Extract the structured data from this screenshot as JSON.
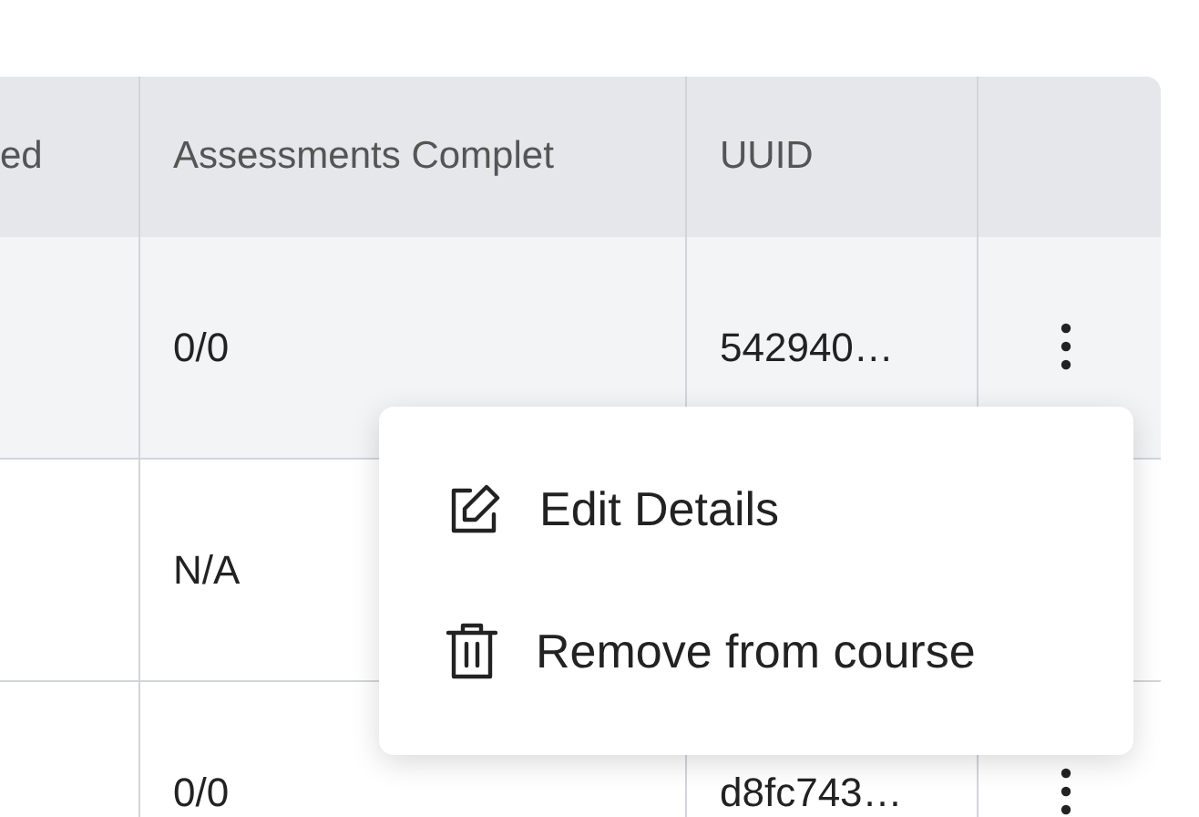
{
  "table": {
    "columns": [
      "ed",
      "Assessments Complet",
      "UUID",
      ""
    ],
    "rows": [
      {
        "assessments": "0/0",
        "uuid": "542940…",
        "highlighted": true
      },
      {
        "assessments": "N/A",
        "uuid": "",
        "highlighted": false
      },
      {
        "assessments": "0/0",
        "uuid": "d8fc743…",
        "highlighted": false
      }
    ]
  },
  "context_menu": {
    "items": [
      {
        "label": "Edit Details",
        "kind": "edit"
      },
      {
        "label": "Remove from course",
        "kind": "delete"
      }
    ]
  }
}
